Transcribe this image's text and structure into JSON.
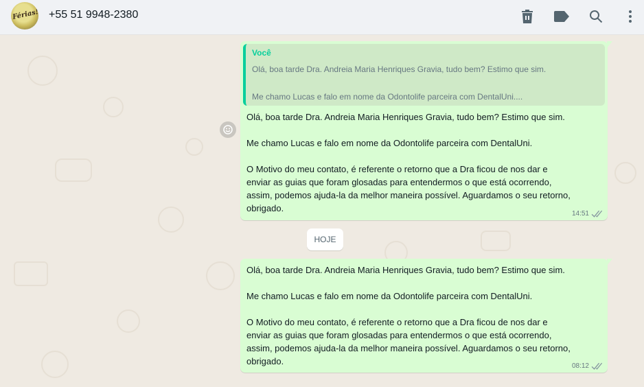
{
  "header": {
    "avatar_text": "Férias!",
    "contact_name": "+55 51 9948-2380",
    "icons": [
      "trash-icon",
      "label-icon",
      "search-icon",
      "menu-dots-icon"
    ]
  },
  "messages": [
    {
      "quote": {
        "author": "Você",
        "line1": "Olá, boa tarde Dra. Andreia Maria Henriques Gravia, tudo bem? Estimo que sim.",
        "line2": "Me chamo Lucas e falo em nome da Odontolife parceira com DentalUni...."
      },
      "p1": "Olá, boa tarde Dra. Andreia Maria Henriques Gravia, tudo bem? Estimo que sim.",
      "p2": "Me chamo Lucas e falo em nome da Odontolife parceira com DentalUni.",
      "p3_lines": [
        "O Motivo do meu contato, é referente o retorno que a Dra ficou de nos dar e",
        "enviar as guias que foram glosadas para entendermos o que está ocorrendo,",
        "assim, podemos ajuda-la da melhor maneira possível. Aguardamos o seu retorno,",
        "obrigado."
      ],
      "time": "14:51"
    },
    {
      "p1": "Olá, boa tarde Dra. Andreia Maria Henriques Gravia, tudo bem? Estimo que sim.",
      "p2": "Me chamo Lucas e falo em nome da Odontolife parceira com DentalUni.",
      "p3_lines": [
        "O Motivo do meu contato, é referente o retorno que a Dra ficou de nos dar e",
        "enviar as guias que foram glosadas para entendermos o que está ocorrendo,",
        "assim, podemos ajuda-la da melhor maneira possível. Aguardamos o seu retorno,",
        "obrigado."
      ],
      "time": "08:12"
    }
  ],
  "day_divider": "HOJE",
  "colors": {
    "chat_bg": "#efeae2",
    "outgoing_bubble": "#d9fdd3",
    "quote_accent": "#06cf9c",
    "header_bg": "#f0f2f5"
  }
}
